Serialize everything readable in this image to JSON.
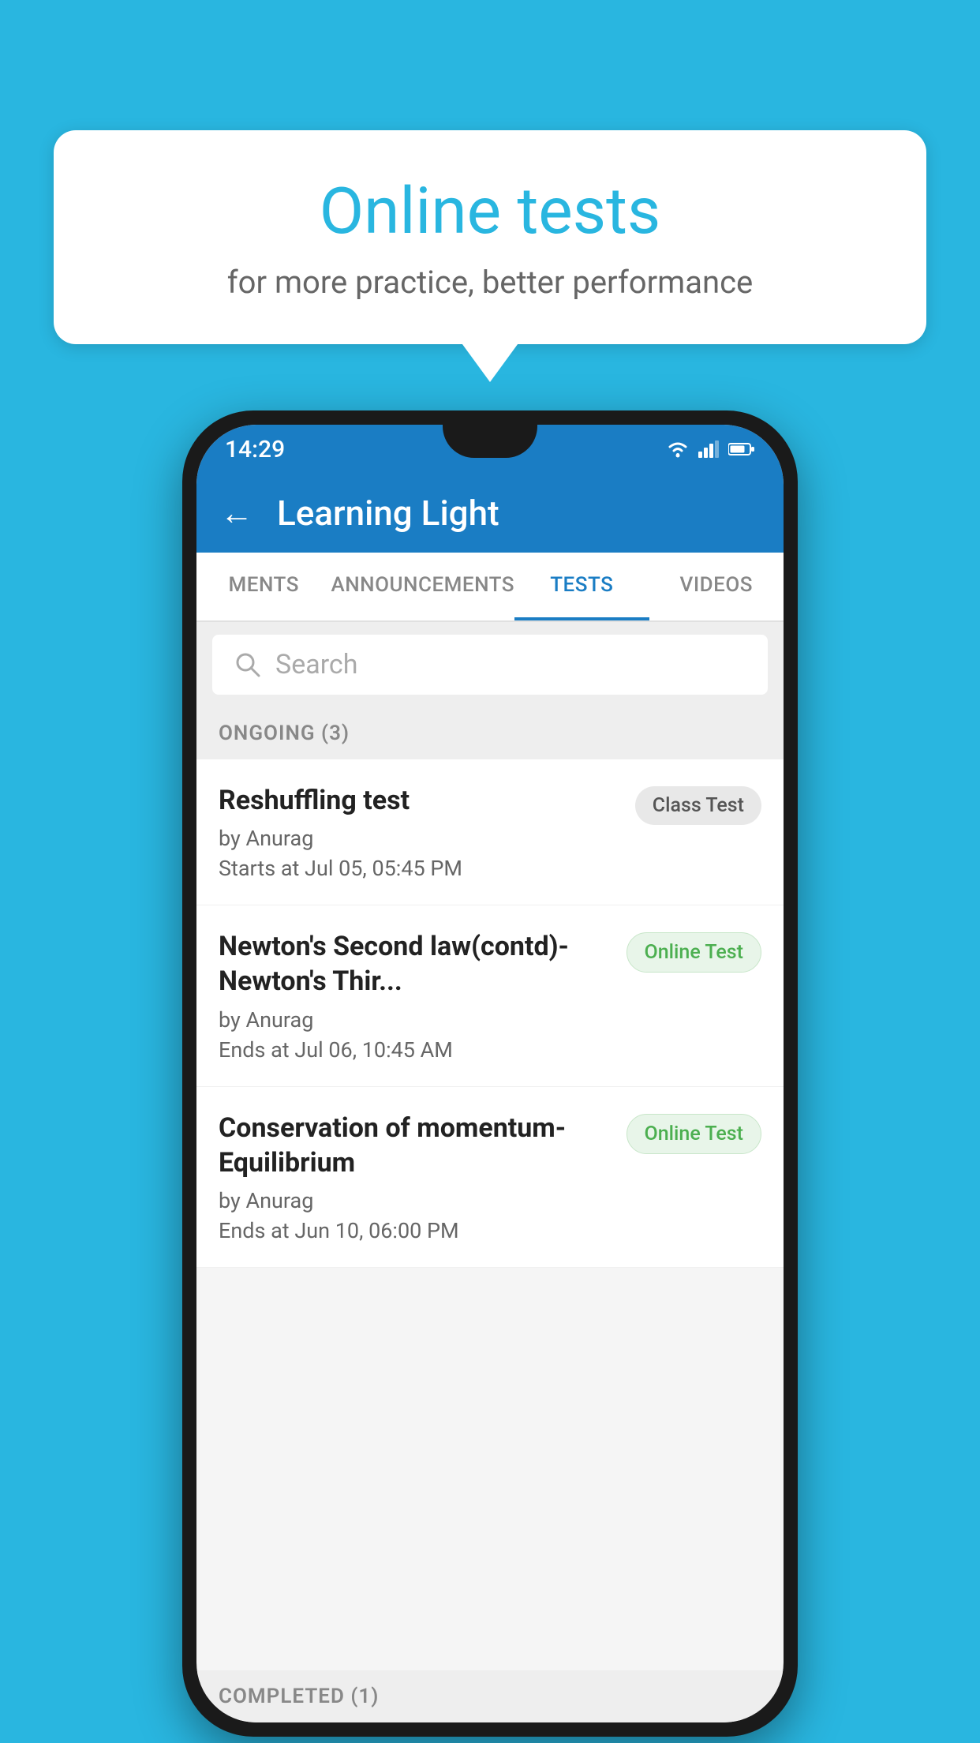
{
  "background_color": "#29b6e0",
  "bubble": {
    "title": "Online tests",
    "subtitle": "for more practice, better performance"
  },
  "phone": {
    "status_bar": {
      "time": "14:29"
    },
    "header": {
      "title": "Learning Light",
      "back_label": "←"
    },
    "tabs": [
      {
        "label": "MENTS",
        "active": false
      },
      {
        "label": "ANNOUNCEMENTS",
        "active": false
      },
      {
        "label": "TESTS",
        "active": true
      },
      {
        "label": "VIDEOS",
        "active": false
      }
    ],
    "search": {
      "placeholder": "Search"
    },
    "sections": [
      {
        "label": "ONGOING (3)",
        "tests": [
          {
            "name": "Reshuffling test",
            "by": "by Anurag",
            "time": "Starts at  Jul 05, 05:45 PM",
            "badge": "Class Test",
            "badge_type": "class"
          },
          {
            "name": "Newton's Second law(contd)-Newton's Thir...",
            "by": "by Anurag",
            "time": "Ends at  Jul 06, 10:45 AM",
            "badge": "Online Test",
            "badge_type": "online"
          },
          {
            "name": "Conservation of momentum-Equilibrium",
            "by": "by Anurag",
            "time": "Ends at  Jun 10, 06:00 PM",
            "badge": "Online Test",
            "badge_type": "online"
          }
        ]
      }
    ],
    "completed_section_label": "COMPLETED (1)"
  }
}
